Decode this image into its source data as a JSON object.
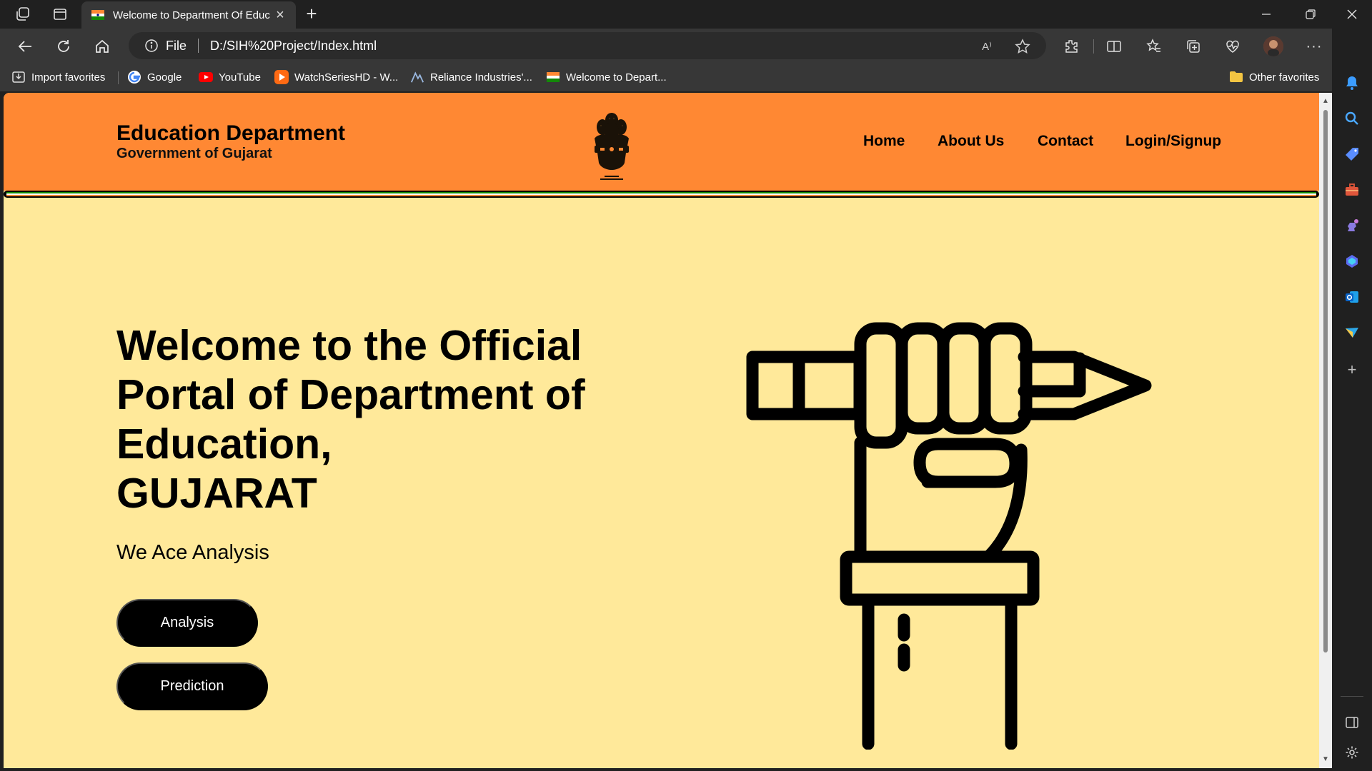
{
  "browser": {
    "tab_title": "Welcome to Department Of Educ",
    "omnibox_scheme": "File",
    "omnibox_url": "D:/SIH%20Project/Index.html",
    "read_aloud_label": "A⁾",
    "favorites": [
      {
        "label": "Import favorites",
        "icon": "import-icon"
      },
      {
        "label": "Google",
        "icon": "google-icon"
      },
      {
        "label": "YouTube",
        "icon": "youtube-icon"
      },
      {
        "label": "WatchSeriesHD - W...",
        "icon": "play-icon"
      },
      {
        "label": "Reliance Industries'...",
        "icon": "reliance-icon"
      },
      {
        "label": "Welcome to Depart...",
        "icon": "flag-icon"
      }
    ],
    "other_favorites": "Other favorites",
    "colors": {
      "chrome_dark": "#202020",
      "chrome_mid": "#373737"
    }
  },
  "site": {
    "brand_title": "Education Department",
    "brand_subtitle": "Government of Gujarat",
    "nav": [
      {
        "label": "Home"
      },
      {
        "label": "About Us"
      },
      {
        "label": "Contact"
      },
      {
        "label": "Login/Signup"
      }
    ],
    "hero_title_lines": [
      "Welcome to the Official",
      "Portal of Department of",
      "Education,",
      "GUJARAT"
    ],
    "hero_subtitle": "We Ace Analysis",
    "buttons": {
      "analysis": "Analysis",
      "prediction": "Prediction"
    },
    "colors": {
      "header_bg": "#ff8833",
      "page_bg": "#ffe99a",
      "saffron": "#ff8833",
      "green": "#138808",
      "button_bg": "#000000"
    }
  }
}
